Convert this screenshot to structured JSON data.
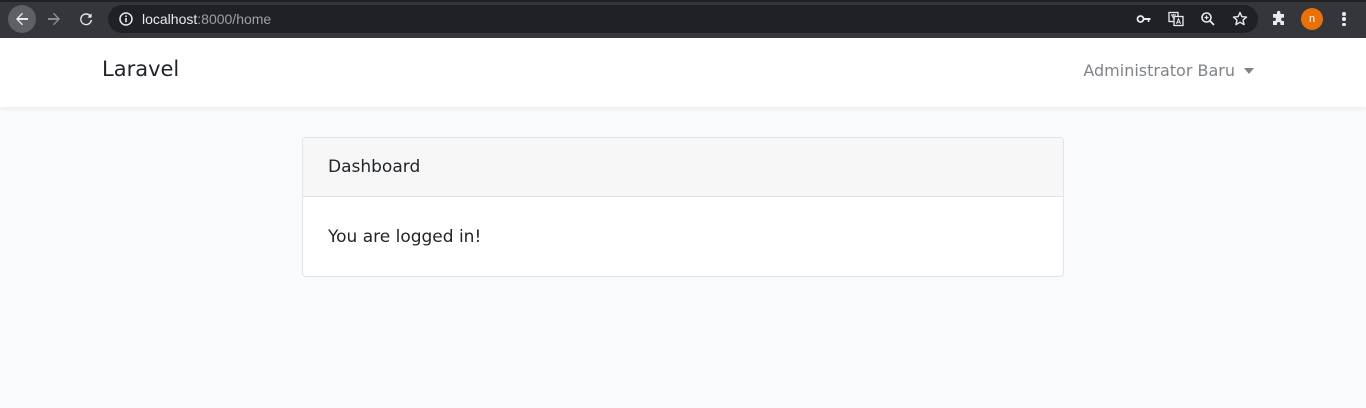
{
  "browser": {
    "url_host": "localhost",
    "url_rest": ":8000/home",
    "profile_initial": "n",
    "icons": [
      "back-arrow-icon",
      "forward-arrow-icon",
      "reload-icon",
      "info-icon",
      "key-icon",
      "translate-icon",
      "zoom-icon",
      "star-icon",
      "extensions-icon",
      "menu-icon"
    ]
  },
  "navbar": {
    "brand": "Laravel",
    "user_name": "Administrator Baru"
  },
  "card": {
    "header": "Dashboard",
    "body": "You are logged in!"
  },
  "colors": {
    "chrome_toolbar": "#35363a",
    "omnibox": "#202124",
    "profile_avatar": "#e8710a",
    "page_background": "#f8fafc",
    "navbar_background": "#ffffff",
    "card_header_background": "#f7f7f7"
  }
}
